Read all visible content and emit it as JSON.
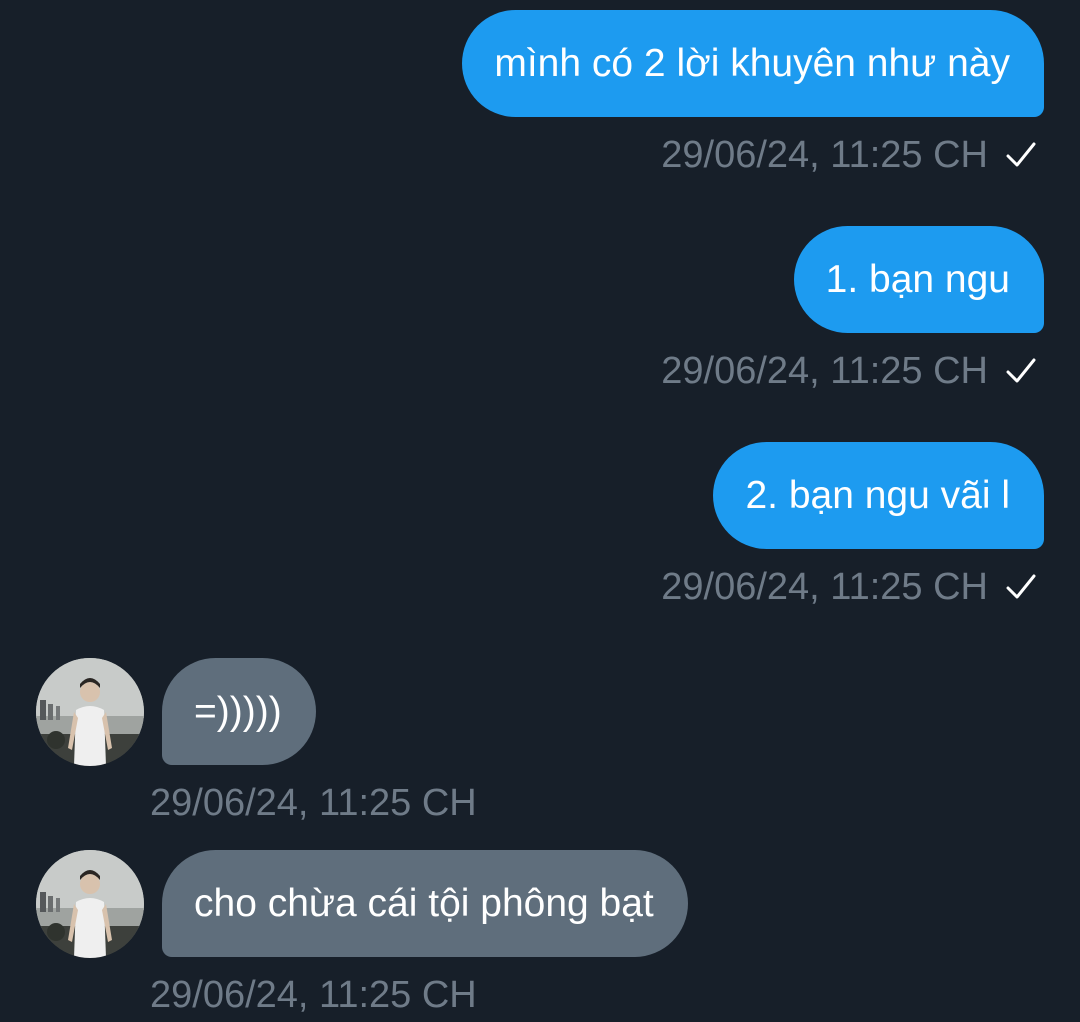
{
  "messages": [
    {
      "direction": "outgoing",
      "text": "mình có 2 lời khuyên như này",
      "time": "29/06/24, 11:25 CH",
      "status_icon": "check-icon"
    },
    {
      "direction": "outgoing",
      "text": "1. bạn ngu",
      "time": "29/06/24, 11:25 CH",
      "status_icon": "check-icon"
    },
    {
      "direction": "outgoing",
      "text": "2. bạn ngu vãi l",
      "time": "29/06/24, 11:25 CH",
      "status_icon": "check-icon"
    },
    {
      "direction": "incoming",
      "text": "=)))))",
      "time": "29/06/24, 11:25 CH",
      "avatar": "avatar"
    },
    {
      "direction": "incoming",
      "text": "cho chừa cái tội phông bạt",
      "time": "29/06/24, 11:25 CH",
      "avatar": "avatar"
    }
  ],
  "colors": {
    "background": "#171f29",
    "outgoing_bubble": "#1d9bf0",
    "incoming_bubble": "#5f6e7c",
    "timestamp": "#6f7b88"
  }
}
